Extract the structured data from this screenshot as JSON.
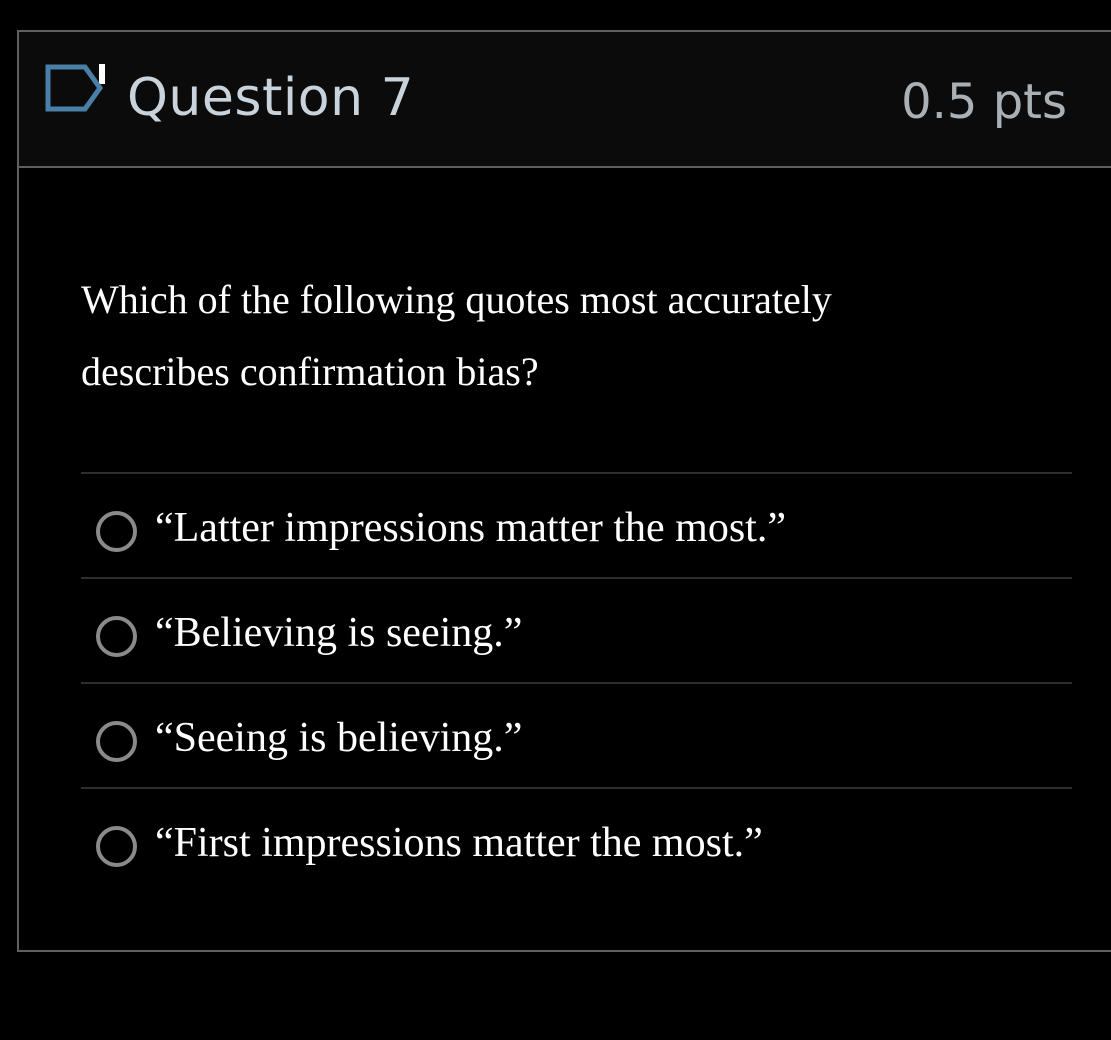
{
  "question": {
    "title": "Question 7",
    "points": "0.5 pts",
    "flag_icon": "flag-bookmark-icon",
    "text_line1": "Which of the following quotes most accurately",
    "text_line2": "describes confirmation bias?"
  },
  "answers": [
    {
      "label": "“Latter impressions matter the most.”"
    },
    {
      "label": "“Believing is seeing.”"
    },
    {
      "label": "“Seeing is believing.”"
    },
    {
      "label": "“First impressions matter the most.”"
    }
  ],
  "colors": {
    "background": "#000000",
    "header_background": "#0b0b0b",
    "border": "#5f5f5f",
    "title_text": "#c9d3dc",
    "points_text": "#a9b1b7",
    "body_text": "#ffffff",
    "radio_border": "#8a8a8a",
    "divider": "#2e2e2e"
  }
}
